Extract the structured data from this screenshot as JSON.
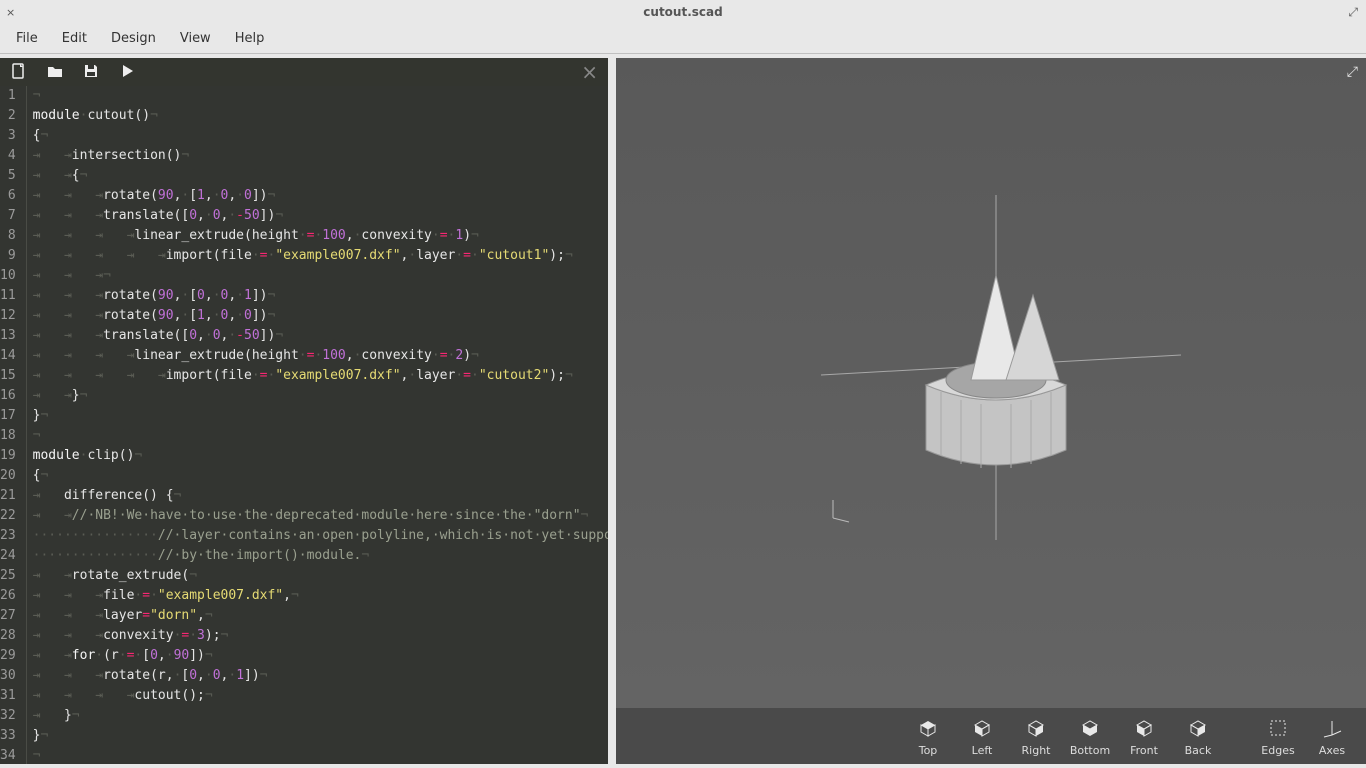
{
  "window": {
    "title": "cutout.scad",
    "close_glyph": "×",
    "restore_glyph": "⤢"
  },
  "menubar": {
    "file": "File",
    "edit": "Edit",
    "design": "Design",
    "view": "View",
    "help": "Help"
  },
  "editor_toolbar": {
    "new_name": "new-icon",
    "open_name": "open-icon",
    "save_name": "save-icon",
    "preview_name": "play-icon",
    "close_glyph": "×"
  },
  "code": {
    "line_count": 34,
    "lines": [
      [
        [
          "ws",
          "¬"
        ]
      ],
      [
        [
          "kw",
          "module"
        ],
        [
          "ws",
          "·"
        ],
        [
          "name",
          "cutout"
        ],
        [
          "fn",
          "()"
        ],
        [
          "ws",
          "¬"
        ]
      ],
      [
        [
          "fn",
          "{"
        ],
        [
          "ws",
          "¬"
        ]
      ],
      [
        [
          "ws",
          "⇥"
        ],
        [
          "ws",
          "   "
        ],
        [
          "ws",
          "⇥"
        ],
        [
          "fn",
          "intersection()"
        ],
        [
          "ws",
          "¬"
        ]
      ],
      [
        [
          "ws",
          "⇥"
        ],
        [
          "ws",
          "   "
        ],
        [
          "ws",
          "⇥"
        ],
        [
          "fn",
          "{"
        ],
        [
          "ws",
          "¬"
        ]
      ],
      [
        [
          "ws",
          "⇥"
        ],
        [
          "ws",
          "   "
        ],
        [
          "ws",
          "⇥"
        ],
        [
          "ws",
          "   "
        ],
        [
          "ws",
          "⇥"
        ],
        [
          "fn",
          "rotate("
        ],
        [
          "num",
          "90"
        ],
        [
          "fn",
          ","
        ],
        [
          "ws",
          "·"
        ],
        [
          "fn",
          "["
        ],
        [
          "num",
          "1"
        ],
        [
          "fn",
          ","
        ],
        [
          "ws",
          "·"
        ],
        [
          "num",
          "0"
        ],
        [
          "fn",
          ","
        ],
        [
          "ws",
          "·"
        ],
        [
          "num",
          "0"
        ],
        [
          "fn",
          "])"
        ],
        [
          "ws",
          "¬"
        ]
      ],
      [
        [
          "ws",
          "⇥"
        ],
        [
          "ws",
          "   "
        ],
        [
          "ws",
          "⇥"
        ],
        [
          "ws",
          "   "
        ],
        [
          "ws",
          "⇥"
        ],
        [
          "fn",
          "translate(["
        ],
        [
          "num",
          "0"
        ],
        [
          "fn",
          ","
        ],
        [
          "ws",
          "·"
        ],
        [
          "num",
          "0"
        ],
        [
          "fn",
          ","
        ],
        [
          "ws",
          "·"
        ],
        [
          "op",
          "-"
        ],
        [
          "num",
          "50"
        ],
        [
          "fn",
          "])"
        ],
        [
          "ws",
          "¬"
        ]
      ],
      [
        [
          "ws",
          "⇥"
        ],
        [
          "ws",
          "   "
        ],
        [
          "ws",
          "⇥"
        ],
        [
          "ws",
          "   "
        ],
        [
          "ws",
          "⇥"
        ],
        [
          "ws",
          "   "
        ],
        [
          "ws",
          "⇥"
        ],
        [
          "fn",
          "linear_extrude(height"
        ],
        [
          "ws",
          "·"
        ],
        [
          "op",
          "="
        ],
        [
          "ws",
          "·"
        ],
        [
          "num",
          "100"
        ],
        [
          "fn",
          ","
        ],
        [
          "ws",
          "·"
        ],
        [
          "fn",
          "convexity"
        ],
        [
          "ws",
          "·"
        ],
        [
          "op",
          "="
        ],
        [
          "ws",
          "·"
        ],
        [
          "num",
          "1"
        ],
        [
          "fn",
          ")"
        ],
        [
          "ws",
          "¬"
        ]
      ],
      [
        [
          "ws",
          "⇥"
        ],
        [
          "ws",
          "   "
        ],
        [
          "ws",
          "⇥"
        ],
        [
          "ws",
          "   "
        ],
        [
          "ws",
          "⇥"
        ],
        [
          "ws",
          "   "
        ],
        [
          "ws",
          "⇥"
        ],
        [
          "ws",
          "   "
        ],
        [
          "ws",
          "⇥"
        ],
        [
          "fn",
          "import(file"
        ],
        [
          "ws",
          "·"
        ],
        [
          "op",
          "="
        ],
        [
          "ws",
          "·"
        ],
        [
          "str",
          "\"example007.dxf\""
        ],
        [
          "fn",
          ","
        ],
        [
          "ws",
          "·"
        ],
        [
          "fn",
          "layer"
        ],
        [
          "ws",
          "·"
        ],
        [
          "op",
          "="
        ],
        [
          "ws",
          "·"
        ],
        [
          "str",
          "\"cutout1\""
        ],
        [
          "fn",
          ");"
        ],
        [
          "ws",
          "¬"
        ]
      ],
      [
        [
          "ws",
          "⇥"
        ],
        [
          "ws",
          "   "
        ],
        [
          "ws",
          "⇥"
        ],
        [
          "ws",
          "   "
        ],
        [
          "ws",
          "⇥"
        ],
        [
          "ws",
          "¬"
        ]
      ],
      [
        [
          "ws",
          "⇥"
        ],
        [
          "ws",
          "   "
        ],
        [
          "ws",
          "⇥"
        ],
        [
          "ws",
          "   "
        ],
        [
          "ws",
          "⇥"
        ],
        [
          "fn",
          "rotate("
        ],
        [
          "num",
          "90"
        ],
        [
          "fn",
          ","
        ],
        [
          "ws",
          "·"
        ],
        [
          "fn",
          "["
        ],
        [
          "num",
          "0"
        ],
        [
          "fn",
          ","
        ],
        [
          "ws",
          "·"
        ],
        [
          "num",
          "0"
        ],
        [
          "fn",
          ","
        ],
        [
          "ws",
          "·"
        ],
        [
          "num",
          "1"
        ],
        [
          "fn",
          "])"
        ],
        [
          "ws",
          "¬"
        ]
      ],
      [
        [
          "ws",
          "⇥"
        ],
        [
          "ws",
          "   "
        ],
        [
          "ws",
          "⇥"
        ],
        [
          "ws",
          "   "
        ],
        [
          "ws",
          "⇥"
        ],
        [
          "fn",
          "rotate("
        ],
        [
          "num",
          "90"
        ],
        [
          "fn",
          ","
        ],
        [
          "ws",
          "·"
        ],
        [
          "fn",
          "["
        ],
        [
          "num",
          "1"
        ],
        [
          "fn",
          ","
        ],
        [
          "ws",
          "·"
        ],
        [
          "num",
          "0"
        ],
        [
          "fn",
          ","
        ],
        [
          "ws",
          "·"
        ],
        [
          "num",
          "0"
        ],
        [
          "fn",
          "])"
        ],
        [
          "ws",
          "¬"
        ]
      ],
      [
        [
          "ws",
          "⇥"
        ],
        [
          "ws",
          "   "
        ],
        [
          "ws",
          "⇥"
        ],
        [
          "ws",
          "   "
        ],
        [
          "ws",
          "⇥"
        ],
        [
          "fn",
          "translate(["
        ],
        [
          "num",
          "0"
        ],
        [
          "fn",
          ","
        ],
        [
          "ws",
          "·"
        ],
        [
          "num",
          "0"
        ],
        [
          "fn",
          ","
        ],
        [
          "ws",
          "·"
        ],
        [
          "op",
          "-"
        ],
        [
          "num",
          "50"
        ],
        [
          "fn",
          "])"
        ],
        [
          "ws",
          "¬"
        ]
      ],
      [
        [
          "ws",
          "⇥"
        ],
        [
          "ws",
          "   "
        ],
        [
          "ws",
          "⇥"
        ],
        [
          "ws",
          "   "
        ],
        [
          "ws",
          "⇥"
        ],
        [
          "ws",
          "   "
        ],
        [
          "ws",
          "⇥"
        ],
        [
          "fn",
          "linear_extrude(height"
        ],
        [
          "ws",
          "·"
        ],
        [
          "op",
          "="
        ],
        [
          "ws",
          "·"
        ],
        [
          "num",
          "100"
        ],
        [
          "fn",
          ","
        ],
        [
          "ws",
          "·"
        ],
        [
          "fn",
          "convexity"
        ],
        [
          "ws",
          "·"
        ],
        [
          "op",
          "="
        ],
        [
          "ws",
          "·"
        ],
        [
          "num",
          "2"
        ],
        [
          "fn",
          ")"
        ],
        [
          "ws",
          "¬"
        ]
      ],
      [
        [
          "ws",
          "⇥"
        ],
        [
          "ws",
          "   "
        ],
        [
          "ws",
          "⇥"
        ],
        [
          "ws",
          "   "
        ],
        [
          "ws",
          "⇥"
        ],
        [
          "ws",
          "   "
        ],
        [
          "ws",
          "⇥"
        ],
        [
          "ws",
          "   "
        ],
        [
          "ws",
          "⇥"
        ],
        [
          "fn",
          "import(file"
        ],
        [
          "ws",
          "·"
        ],
        [
          "op",
          "="
        ],
        [
          "ws",
          "·"
        ],
        [
          "str",
          "\"example007.dxf\""
        ],
        [
          "fn",
          ","
        ],
        [
          "ws",
          "·"
        ],
        [
          "fn",
          "layer"
        ],
        [
          "ws",
          "·"
        ],
        [
          "op",
          "="
        ],
        [
          "ws",
          "·"
        ],
        [
          "str",
          "\"cutout2\""
        ],
        [
          "fn",
          ");"
        ],
        [
          "ws",
          "¬"
        ]
      ],
      [
        [
          "ws",
          "⇥"
        ],
        [
          "ws",
          "   "
        ],
        [
          "ws",
          "⇥"
        ],
        [
          "fn",
          "}"
        ],
        [
          "ws",
          "¬"
        ]
      ],
      [
        [
          "fn",
          "}"
        ],
        [
          "ws",
          "¬"
        ]
      ],
      [
        [
          "ws",
          "¬"
        ]
      ],
      [
        [
          "kw",
          "module"
        ],
        [
          "ws",
          "·"
        ],
        [
          "name",
          "clip"
        ],
        [
          "fn",
          "()"
        ],
        [
          "ws",
          "¬"
        ]
      ],
      [
        [
          "fn",
          "{"
        ],
        [
          "ws",
          "¬"
        ]
      ],
      [
        [
          "ws",
          "⇥"
        ],
        [
          "ws",
          "   "
        ],
        [
          "fn",
          "difference() {"
        ],
        [
          "ws",
          "¬"
        ]
      ],
      [
        [
          "ws",
          "⇥"
        ],
        [
          "ws",
          "   "
        ],
        [
          "ws",
          "⇥"
        ],
        [
          "com",
          "//·NB!·We·have·to·use·the·deprecated·module·here·since·the·\"dorn\""
        ],
        [
          "ws",
          "¬"
        ]
      ],
      [
        [
          "ws",
          "················"
        ],
        [
          "com",
          "//·layer·contains·an·open·polyline,·which·is·not·yet·supported"
        ],
        [
          "ws",
          "¬"
        ]
      ],
      [
        [
          "ws",
          "················"
        ],
        [
          "com",
          "//·by·the·import()·module."
        ],
        [
          "ws",
          "¬"
        ]
      ],
      [
        [
          "ws",
          "⇥"
        ],
        [
          "ws",
          "   "
        ],
        [
          "ws",
          "⇥"
        ],
        [
          "fn",
          "rotate_extrude("
        ],
        [
          "ws",
          "¬"
        ]
      ],
      [
        [
          "ws",
          "⇥"
        ],
        [
          "ws",
          "   "
        ],
        [
          "ws",
          "⇥"
        ],
        [
          "ws",
          "   "
        ],
        [
          "ws",
          "⇥"
        ],
        [
          "fn",
          "file"
        ],
        [
          "ws",
          "·"
        ],
        [
          "op",
          "="
        ],
        [
          "ws",
          "·"
        ],
        [
          "str",
          "\"example007.dxf\""
        ],
        [
          "fn",
          ","
        ],
        [
          "ws",
          "¬"
        ]
      ],
      [
        [
          "ws",
          "⇥"
        ],
        [
          "ws",
          "   "
        ],
        [
          "ws",
          "⇥"
        ],
        [
          "ws",
          "   "
        ],
        [
          "ws",
          "⇥"
        ],
        [
          "fn",
          "layer"
        ],
        [
          "op",
          "="
        ],
        [
          "str",
          "\"dorn\""
        ],
        [
          "fn",
          ","
        ],
        [
          "ws",
          "¬"
        ]
      ],
      [
        [
          "ws",
          "⇥"
        ],
        [
          "ws",
          "   "
        ],
        [
          "ws",
          "⇥"
        ],
        [
          "ws",
          "   "
        ],
        [
          "ws",
          "⇥"
        ],
        [
          "fn",
          "convexity"
        ],
        [
          "ws",
          "·"
        ],
        [
          "op",
          "="
        ],
        [
          "ws",
          "·"
        ],
        [
          "num",
          "3"
        ],
        [
          "fn",
          ");"
        ],
        [
          "ws",
          "¬"
        ]
      ],
      [
        [
          "ws",
          "⇥"
        ],
        [
          "ws",
          "   "
        ],
        [
          "ws",
          "⇥"
        ],
        [
          "kw",
          "for"
        ],
        [
          "ws",
          "·"
        ],
        [
          "fn",
          "(r"
        ],
        [
          "ws",
          "·"
        ],
        [
          "op",
          "="
        ],
        [
          "ws",
          "·"
        ],
        [
          "fn",
          "["
        ],
        [
          "num",
          "0"
        ],
        [
          "fn",
          ","
        ],
        [
          "ws",
          "·"
        ],
        [
          "num",
          "90"
        ],
        [
          "fn",
          "])"
        ],
        [
          "ws",
          "¬"
        ]
      ],
      [
        [
          "ws",
          "⇥"
        ],
        [
          "ws",
          "   "
        ],
        [
          "ws",
          "⇥"
        ],
        [
          "ws",
          "   "
        ],
        [
          "ws",
          "⇥"
        ],
        [
          "fn",
          "rotate(r,"
        ],
        [
          "ws",
          "·"
        ],
        [
          "fn",
          "["
        ],
        [
          "num",
          "0"
        ],
        [
          "fn",
          ","
        ],
        [
          "ws",
          "·"
        ],
        [
          "num",
          "0"
        ],
        [
          "fn",
          ","
        ],
        [
          "ws",
          "·"
        ],
        [
          "num",
          "1"
        ],
        [
          "fn",
          "])"
        ],
        [
          "ws",
          "¬"
        ]
      ],
      [
        [
          "ws",
          "⇥"
        ],
        [
          "ws",
          "   "
        ],
        [
          "ws",
          "⇥"
        ],
        [
          "ws",
          "   "
        ],
        [
          "ws",
          "⇥"
        ],
        [
          "ws",
          "   "
        ],
        [
          "ws",
          "⇥"
        ],
        [
          "fn",
          "cutout();"
        ],
        [
          "ws",
          "¬"
        ]
      ],
      [
        [
          "ws",
          "⇥"
        ],
        [
          "ws",
          "   "
        ],
        [
          "fn",
          "}"
        ],
        [
          "ws",
          "¬"
        ]
      ],
      [
        [
          "fn",
          "}"
        ],
        [
          "ws",
          "¬"
        ]
      ],
      [
        [
          "ws",
          "¬"
        ]
      ]
    ]
  },
  "viewer": {
    "buttons": {
      "top": "Top",
      "left": "Left",
      "right": "Right",
      "bottom": "Bottom",
      "front": "Front",
      "back": "Back",
      "edges": "Edges",
      "axes": "Axes"
    }
  }
}
